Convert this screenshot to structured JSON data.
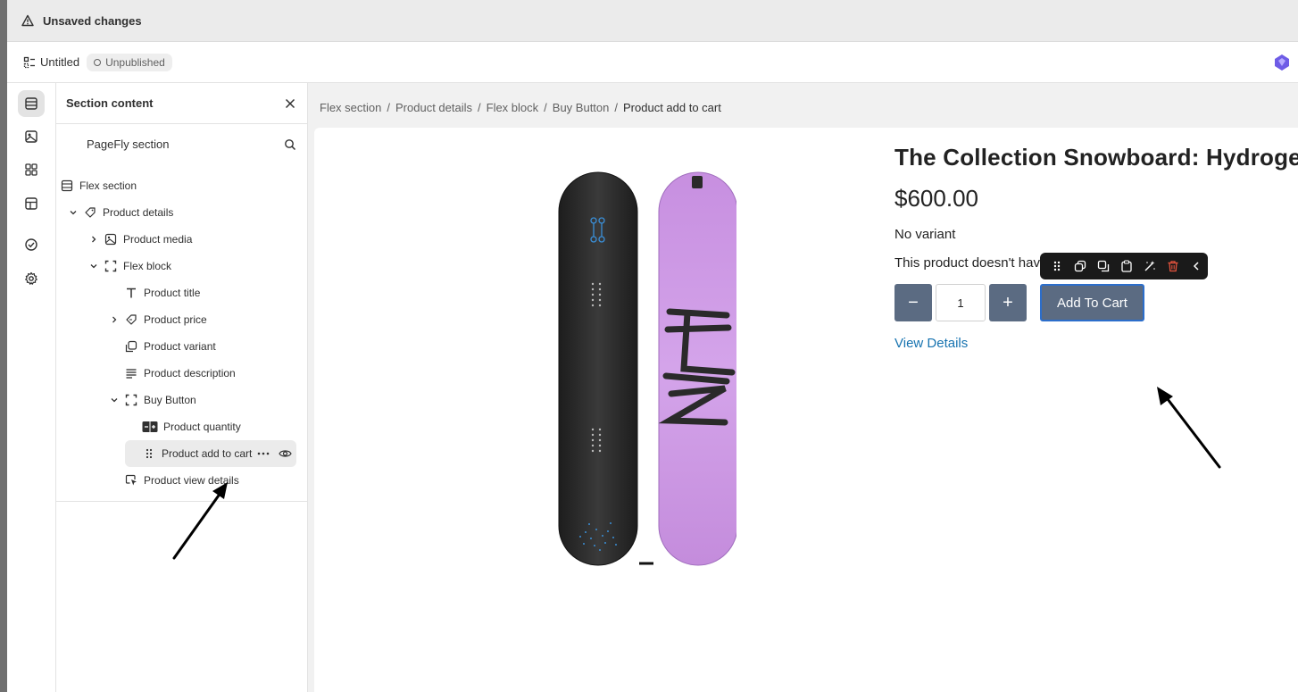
{
  "unsaved_bar": {
    "text": "Unsaved changes"
  },
  "topbar": {
    "page_title": "Untitled",
    "status_badge": "Unpublished"
  },
  "rail": {
    "items": [
      "layers-icon",
      "media-icon",
      "elements-icon",
      "templates-icon",
      "checklist-icon",
      "settings-icon"
    ],
    "active_index": 0
  },
  "panel": {
    "title": "Section content",
    "subtitle": "PageFly section",
    "tree": [
      {
        "label": "Flex section",
        "icon": "section-icon",
        "level": 0,
        "expanded": false,
        "chevron": false
      },
      {
        "label": "Product details",
        "icon": "tag-icon",
        "level": 1,
        "expanded": true,
        "chevron": true
      },
      {
        "label": "Product media",
        "icon": "image-icon",
        "level": 2,
        "expanded": false,
        "chevron": true
      },
      {
        "label": "Flex block",
        "icon": "frame-icon",
        "level": 2,
        "expanded": true,
        "chevron": true
      },
      {
        "label": "Product title",
        "icon": "text-icon",
        "level": 3,
        "expanded": false,
        "chevron": false
      },
      {
        "label": "Product price",
        "icon": "price-tag-icon",
        "level": 3,
        "expanded": false,
        "chevron": true
      },
      {
        "label": "Product variant",
        "icon": "variant-icon",
        "level": 3,
        "expanded": false,
        "chevron": false
      },
      {
        "label": "Product description",
        "icon": "paragraph-icon",
        "level": 3,
        "expanded": false,
        "chevron": false
      },
      {
        "label": "Buy Button",
        "icon": "frame-icon",
        "level": 3,
        "expanded": true,
        "chevron": true
      },
      {
        "label": "Product quantity",
        "icon": "quantity-icon",
        "level": 4,
        "expanded": false,
        "chevron": false
      },
      {
        "label": "Product add to cart",
        "icon": "drag-handle-icon",
        "level": 4,
        "expanded": false,
        "chevron": false,
        "selected": true
      },
      {
        "label": "Product view details",
        "icon": "cursor-click-icon",
        "level": 3,
        "expanded": false,
        "chevron": false
      }
    ]
  },
  "breadcrumb": [
    "Flex section",
    "Product details",
    "Flex block",
    "Buy Button",
    "Product add to cart"
  ],
  "product": {
    "title": "The Collection Snowboard: Hydroge",
    "price": "$600.00",
    "variant": "No variant",
    "description": "This product doesn't hav",
    "quantity": "1",
    "qty_minus": "−",
    "qty_plus": "+",
    "add_to_cart": "Add To Cart",
    "view_details": "View Details"
  },
  "element_toolbar": {
    "tools": [
      "drag-icon",
      "duplicate-icon",
      "copy-icon",
      "paste-icon",
      "magic-icon",
      "delete-icon",
      "collapse-icon"
    ]
  },
  "colors": {
    "button_bg": "#5b6b82",
    "link": "#1773b0",
    "focus_border": "#2c6ecb",
    "board_purple": "#c993e0",
    "board_dark": "#2a2a2a",
    "delete_red": "#e5533d"
  }
}
